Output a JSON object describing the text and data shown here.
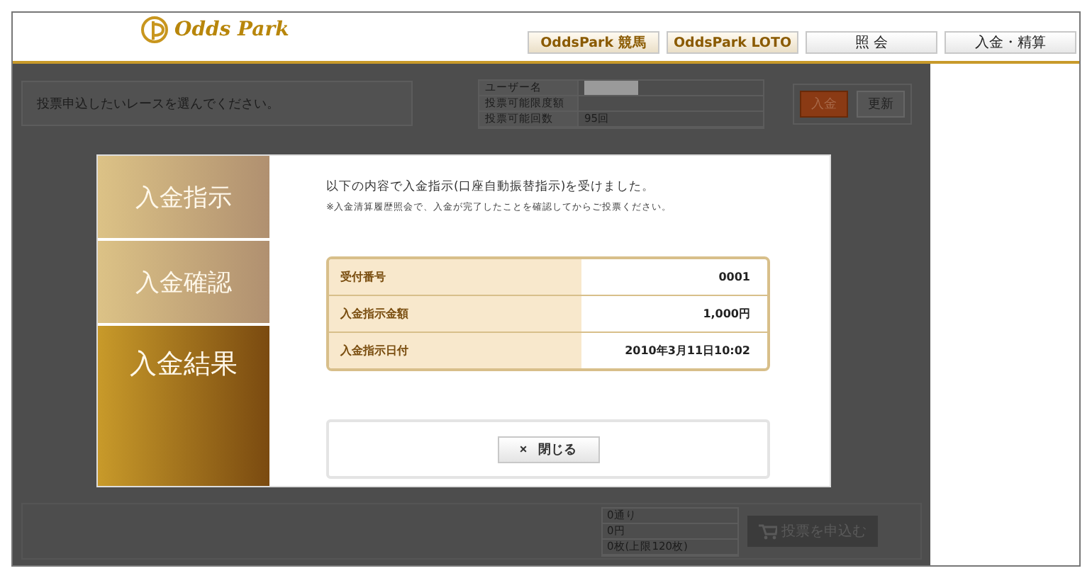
{
  "header": {
    "logo": "Odds Park",
    "nav": [
      {
        "label": "OddsPark 競馬",
        "kind": "brand"
      },
      {
        "label": "OddsPark LOTO",
        "kind": "brand"
      },
      {
        "label": "照 会",
        "kind": "plain"
      },
      {
        "label": "入金・精算",
        "kind": "plain"
      }
    ]
  },
  "background": {
    "prompt": "投票申込したいレースを選んでください。",
    "account": [
      {
        "label": "ユーザー名",
        "redacted": true
      },
      {
        "label": "投票可能限度額",
        "redacted": false
      },
      {
        "label": "投票可能回数",
        "value": "95回",
        "redacted": false
      }
    ],
    "deposit_button": "入金",
    "refresh_button": "更新",
    "summary": [
      "0通り",
      "0円",
      "0枚(上限120枚)"
    ],
    "purchase_button": "投票を申込む"
  },
  "modal": {
    "steps": [
      {
        "label": "入金指示",
        "selected": false
      },
      {
        "label": "入金確認",
        "selected": false
      },
      {
        "label": "入金結果",
        "selected": true
      }
    ],
    "message": "以下の内容で入金指示(口座自動振替指示)を受けました。",
    "note": "※入金清算履歴照会で、入金が完了したことを確認してからご投票ください。",
    "details": [
      {
        "label": "受付番号",
        "value": "0001"
      },
      {
        "label": "入金指示金額",
        "value": "1,000円"
      },
      {
        "label": "入金指示日付",
        "value": "2010年3月11日10:02"
      }
    ],
    "close_button": {
      "icon": "×",
      "label": "閉じる"
    }
  }
}
